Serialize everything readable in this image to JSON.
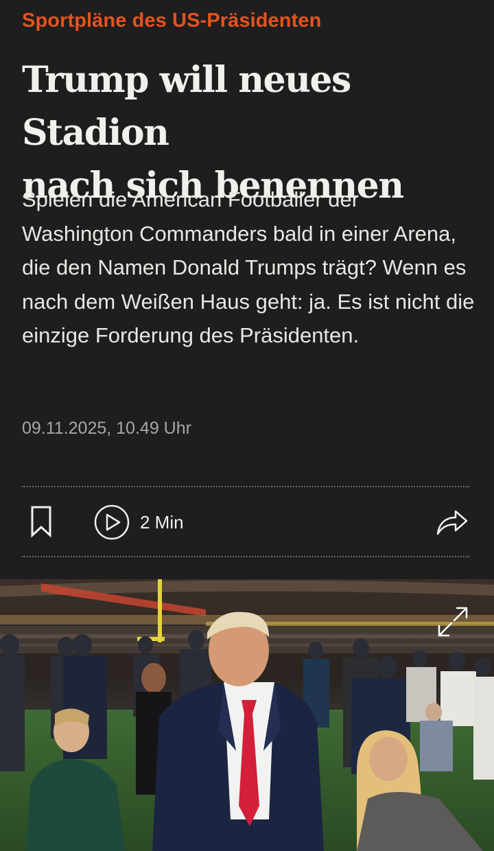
{
  "article": {
    "kicker": "Sportpläne des US-Präsidenten",
    "headline_line1": "Trump will neues Stadion",
    "headline_line2": "nach sich benennen",
    "teaser": "Spielen die American Footballer der Washington Commanders bald in einer Arena, die den Namen Donald Trumps trägt? Wenn es nach dem Weißen Haus geht: ja. Es ist nicht die einzige Forderung des Präsidenten.",
    "date": "09.11.2025, 10.49 Uhr"
  },
  "toolbar": {
    "bookmark_icon": "bookmark-icon",
    "audio_icon": "play-circle-icon",
    "audio_label": "2 Min",
    "share_icon": "share-arrow-icon"
  },
  "hero_image": {
    "subject": "Donald Trump auf einem Footballfeld im Stadion",
    "expand_icon": "expand-arrows-icon"
  },
  "colors": {
    "background": "#1f1e1e",
    "kicker": "#e5531f",
    "headline": "#f1f0ec",
    "date": "#a9a7a3"
  }
}
